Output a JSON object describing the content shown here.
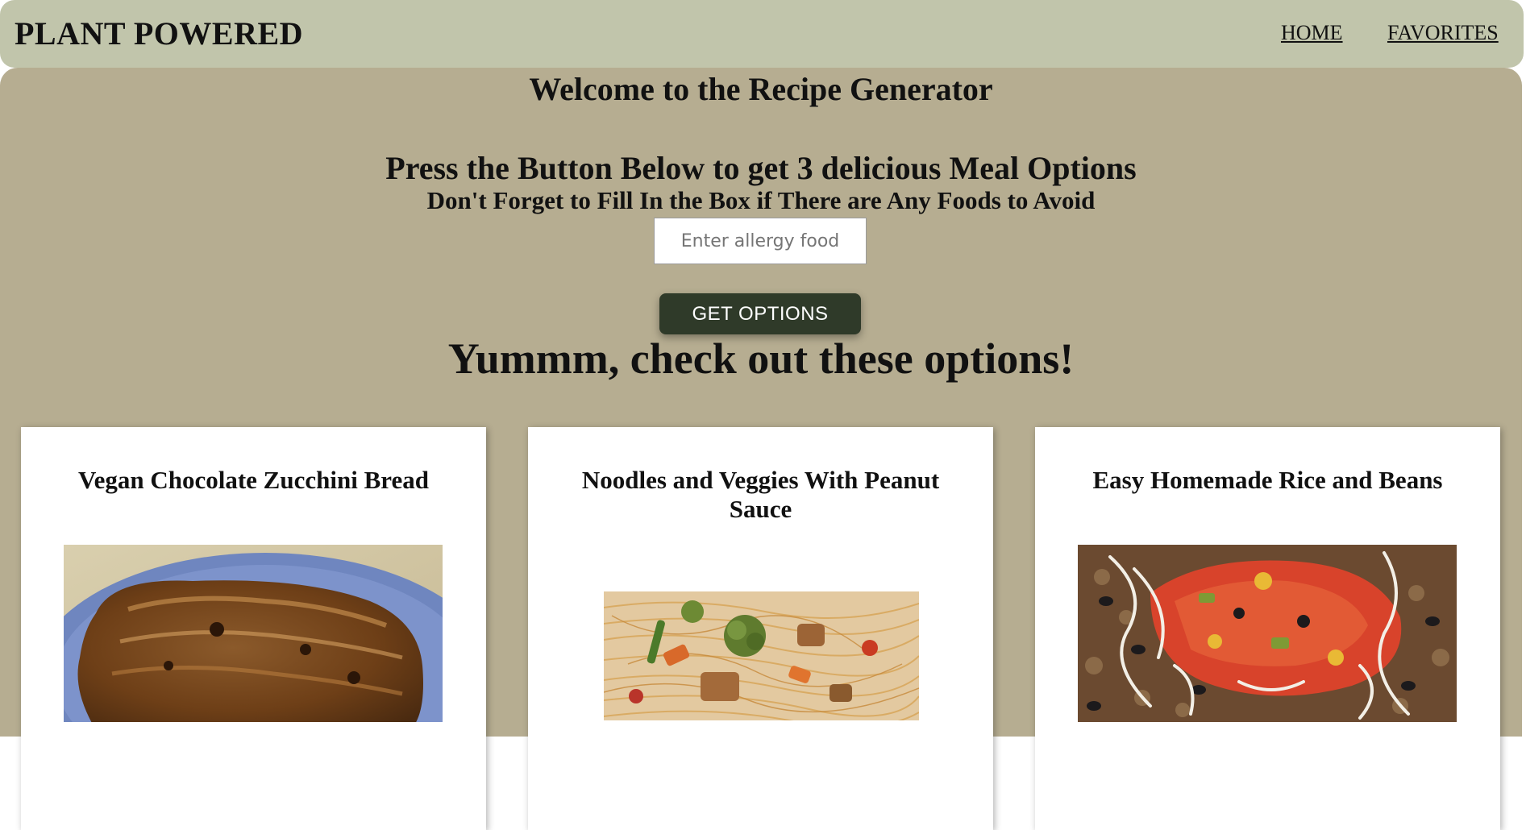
{
  "brand": "PLANT POWERED",
  "nav": {
    "home": "HOME",
    "favorites": "FAVORITES"
  },
  "hero": {
    "welcome": "Welcome to the Recipe Generator",
    "instruction": "Press the Button Below to get 3 delicious Meal Options",
    "reminder": "Don't Forget to Fill In the Box if There are Any Foods to Avoid",
    "input_placeholder": "Enter allergy food",
    "input_value": "",
    "button_label": "GET OPTIONS",
    "results_heading": "Yummm, check out these options!"
  },
  "recipes": [
    {
      "title": "Vegan Chocolate Zucchini Bread",
      "image": "zucchini-bread-photo"
    },
    {
      "title": "Noodles and Veggies With Peanut Sauce",
      "image": "noodles-veggies-photo"
    },
    {
      "title": "Easy Homemade Rice and Beans",
      "image": "rice-beans-photo"
    }
  ],
  "colors": {
    "navbar_bg": "#c1c5ab",
    "main_bg": "#b6ad91",
    "button_bg": "#2f3a29",
    "card_bg": "#ffffff"
  }
}
